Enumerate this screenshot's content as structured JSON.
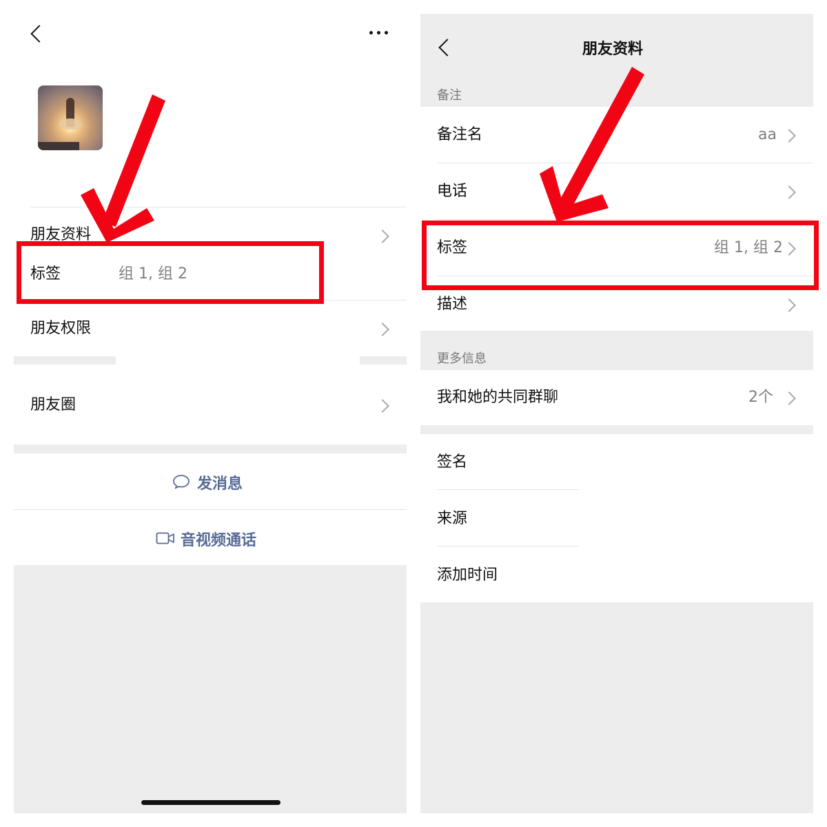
{
  "left": {
    "rows": {
      "friend_profile": "朋友资料",
      "tags_label": "标签",
      "tags_value": "组 1, 组 2",
      "friend_permissions": "朋友权限",
      "moments": "朋友圈"
    },
    "actions": {
      "send_message": "发消息",
      "av_call": "音视频通话"
    }
  },
  "right": {
    "title": "朋友资料",
    "section_remarks": "备注",
    "remark_name_label": "备注名",
    "remark_name_value": "aa",
    "phone_label": "电话",
    "tags_label": "标签",
    "tags_value": "组 1, 组 2",
    "description_label": "描述",
    "section_more_info": "更多信息",
    "common_groups_label": "我和她的共同群聊",
    "common_groups_value": "2个",
    "signature_label": "签名",
    "source_label": "来源",
    "added_time_label": "添加时间"
  },
  "colors": {
    "annotation_red": "#f10515",
    "link_blue": "#576b95",
    "panel_gray": "#ededed"
  },
  "icons": [
    "back-icon",
    "more-icon",
    "chevron-right-icon",
    "message-bubble-icon",
    "video-camera-icon",
    "red-arrow"
  ]
}
